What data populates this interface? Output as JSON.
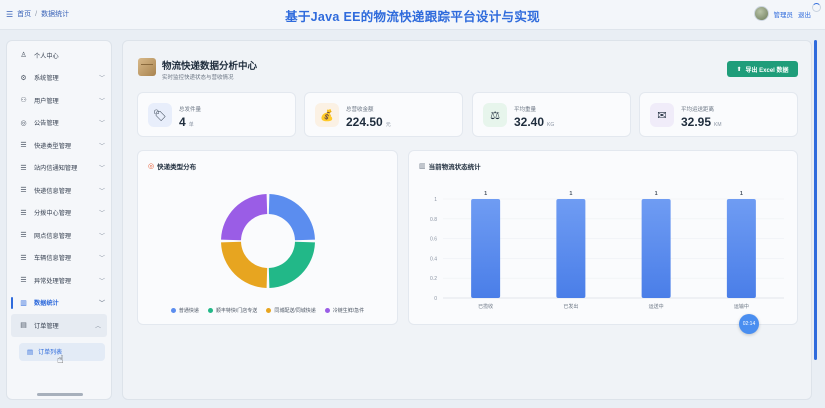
{
  "header": {
    "breadcrumb": [
      "首页",
      "数据统计"
    ],
    "breadcrumb_sep": "/",
    "title": "基于Java EE的物流快递跟踪平台设计与实现",
    "user_name": "管理员",
    "logout_label": "退出"
  },
  "sidebar": {
    "items": [
      {
        "label": "个人中心",
        "icon": "user-icon",
        "glyph": "♙",
        "chevron": false
      },
      {
        "label": "系统管理",
        "icon": "gear-icon",
        "glyph": "⚙",
        "chevron": true
      },
      {
        "label": "用户管理",
        "icon": "users-icon",
        "glyph": "⚇",
        "chevron": true
      },
      {
        "label": "公告管理",
        "icon": "announcement-icon",
        "glyph": "◎",
        "chevron": true
      },
      {
        "label": "快递类型管理",
        "icon": "list-icon",
        "glyph": "☰",
        "chevron": true
      },
      {
        "label": "站内信通知管理",
        "icon": "list-icon",
        "glyph": "☰",
        "chevron": true
      },
      {
        "label": "快递信息管理",
        "icon": "list-icon",
        "glyph": "☰",
        "chevron": true
      },
      {
        "label": "分拨中心管理",
        "icon": "list-icon",
        "glyph": "☰",
        "chevron": true
      },
      {
        "label": "网点信息管理",
        "icon": "list-icon",
        "glyph": "☰",
        "chevron": true
      },
      {
        "label": "车辆信息管理",
        "icon": "list-icon",
        "glyph": "☰",
        "chevron": true
      },
      {
        "label": "异常处理管理",
        "icon": "list-icon",
        "glyph": "☰",
        "chevron": true
      },
      {
        "label": "数据统计",
        "icon": "chart-icon",
        "glyph": "▥",
        "chevron": true,
        "active": true
      },
      {
        "label": "订单管理",
        "icon": "order-icon",
        "glyph": "▤",
        "chevron": true,
        "open": true
      }
    ],
    "sub_item": {
      "label": "订单列表",
      "icon": "order-list-icon",
      "glyph": "▤"
    }
  },
  "page": {
    "title": "物流快递数据分析中心",
    "subtitle": "实时监控快递状态与营收情况",
    "export_label": "导出 Excel 数据",
    "export_glyph": "⬆"
  },
  "stats": [
    {
      "label": "总发件量",
      "value": "4",
      "unit": "单",
      "icon": "package-icon",
      "glyph": "🏷",
      "bg": "#e8eefb"
    },
    {
      "label": "总营收金额",
      "value": "224.50",
      "unit": "元",
      "icon": "money-bag-icon",
      "glyph": "💰",
      "bg": "#fbf1e4"
    },
    {
      "label": "平均重量",
      "value": "32.40",
      "unit": "KG",
      "icon": "scale-icon",
      "glyph": "⚖",
      "bg": "#e7f5ec"
    },
    {
      "label": "平均运送距离",
      "value": "32.95",
      "unit": "KM",
      "icon": "envelope-icon",
      "glyph": "✉",
      "bg": "#f0ecf9"
    }
  ],
  "pie_panel": {
    "title": "快递类型分布",
    "title_glyph": "◎"
  },
  "bar_panel": {
    "title": "当前物流状态统计",
    "title_glyph": "▥"
  },
  "time_badge": "02:14",
  "colors": {
    "accent": "#2f6bdc",
    "export": "#1f9d7a"
  },
  "chart_data": [
    {
      "type": "pie",
      "title": "快递类型分布",
      "categories": [
        "普通快递",
        "顺丰特快/门店专送",
        "同城配送/同城快递",
        "冷链生鲜/急件"
      ],
      "legend_labels": [
        "普通快递",
        "顺丰特快/门店专送",
        "同城配送/同城快递",
        "冷链生鲜/急件"
      ],
      "values": [
        1,
        1,
        1,
        1
      ],
      "colors": [
        "#5b8def",
        "#22b888",
        "#e7a520",
        "#9a5de6"
      ],
      "legend_position": "bottom"
    },
    {
      "type": "bar",
      "title": "当前物流状态统计",
      "categories": [
        "已揽收",
        "已发出",
        "运送中",
        "运输中"
      ],
      "values": [
        1,
        1,
        1,
        1
      ],
      "data_labels": [
        "1",
        "1",
        "1",
        "1"
      ],
      "yticks": [
        "0",
        "0.2",
        "0.4",
        "0.6",
        "0.8",
        "1"
      ],
      "ylim": [
        0,
        1
      ],
      "color": "#5b8def",
      "grid": true
    }
  ]
}
